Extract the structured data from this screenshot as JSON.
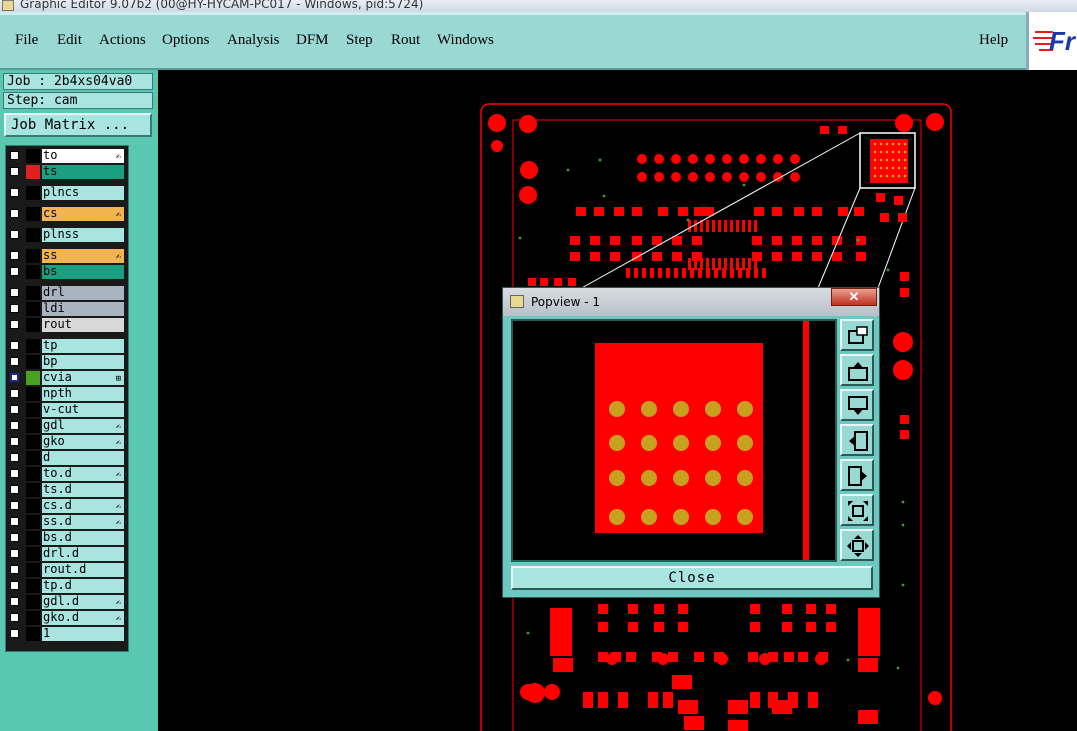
{
  "window": {
    "title": "Graphic Editor 9.07b2 (00@HY-HYCAM-PC017 - Windows, pid:5724)"
  },
  "menu": {
    "items": [
      "File",
      "Edit",
      "Actions",
      "Options",
      "Analysis",
      "DFM",
      "Step",
      "Rout",
      "Windows"
    ],
    "help": "Help",
    "logo": "Fr"
  },
  "job": {
    "label": "Job : 2b4xs04va0",
    "step": "Step: cam",
    "matrix_button": "Job Matrix ..."
  },
  "layers": [
    {
      "name": "to",
      "color": "#ffffff",
      "swatch": "#000000",
      "mark": "✍"
    },
    {
      "name": "ts",
      "color": "#1aa080",
      "swatch": "#e02020",
      "mark": ""
    },
    {
      "name": "plncs",
      "color": "#a8e4e0",
      "swatch": "#000000",
      "mark": ""
    },
    {
      "name": "cs",
      "color": "#f2b450",
      "swatch": "#000000",
      "mark": "✍"
    },
    {
      "name": "plnss",
      "color": "#a8e4e0",
      "swatch": "#000000",
      "mark": ""
    },
    {
      "name": "ss",
      "color": "#f2b450",
      "swatch": "#000000",
      "mark": "✍"
    },
    {
      "name": "bs",
      "color": "#1aa080",
      "swatch": "#000000",
      "mark": ""
    },
    {
      "name": "drl",
      "color": "#a8b4c0",
      "swatch": "#000000",
      "mark": ""
    },
    {
      "name": "ldi",
      "color": "#a8b4c0",
      "swatch": "#000000",
      "mark": ""
    },
    {
      "name": "rout",
      "color": "#d8d8d8",
      "swatch": "#000000",
      "mark": ""
    },
    {
      "name": "tp",
      "color": "#a8e4e0",
      "swatch": "#000000",
      "mark": ""
    },
    {
      "name": "bp",
      "color": "#a8e4e0",
      "swatch": "#000000",
      "mark": ""
    },
    {
      "name": "cvia",
      "color": "#a8e4e0",
      "swatch": "#4aa020",
      "mark": "⊞"
    },
    {
      "name": "npth",
      "color": "#a8e4e0",
      "swatch": "#000000",
      "mark": ""
    },
    {
      "name": "v-cut",
      "color": "#a8e4e0",
      "swatch": "#000000",
      "mark": ""
    },
    {
      "name": "gdl",
      "color": "#a8e4e0",
      "swatch": "#000000",
      "mark": "✍"
    },
    {
      "name": "gko",
      "color": "#a8e4e0",
      "swatch": "#000000",
      "mark": "✍"
    },
    {
      "name": "d",
      "color": "#a8e4e0",
      "swatch": "#000000",
      "mark": ""
    },
    {
      "name": "to.d",
      "color": "#a8e4e0",
      "swatch": "#000000",
      "mark": "✍"
    },
    {
      "name": "ts.d",
      "color": "#a8e4e0",
      "swatch": "#000000",
      "mark": ""
    },
    {
      "name": "cs.d",
      "color": "#a8e4e0",
      "swatch": "#000000",
      "mark": "✍"
    },
    {
      "name": "ss.d",
      "color": "#a8e4e0",
      "swatch": "#000000",
      "mark": "✍"
    },
    {
      "name": "bs.d",
      "color": "#a8e4e0",
      "swatch": "#000000",
      "mark": ""
    },
    {
      "name": "drl.d",
      "color": "#a8e4e0",
      "swatch": "#000000",
      "mark": ""
    },
    {
      "name": "rout.d",
      "color": "#a8e4e0",
      "swatch": "#000000",
      "mark": ""
    },
    {
      "name": "tp.d",
      "color": "#a8e4e0",
      "swatch": "#000000",
      "mark": ""
    },
    {
      "name": "gdl.d",
      "color": "#a8e4e0",
      "swatch": "#000000",
      "mark": "✍"
    },
    {
      "name": "gko.d",
      "color": "#a8e4e0",
      "swatch": "#000000",
      "mark": "✍"
    },
    {
      "name": "1",
      "color": "#a8e4e0",
      "swatch": "#000000",
      "mark": ""
    }
  ],
  "popview": {
    "title": "Popview - 1",
    "close_x": "✕",
    "close_label": "Close",
    "tools": [
      "zoom-fit-icon",
      "pan-up-icon",
      "pan-down-icon",
      "pan-left-icon",
      "pan-right-icon",
      "zoom-in-icon",
      "zoom-out-icon"
    ]
  },
  "colors": {
    "copper": "#ff0000",
    "pad": "#c8a020",
    "menu_bg": "#9ad8d4",
    "panel_bg": "#5ac8b0"
  }
}
